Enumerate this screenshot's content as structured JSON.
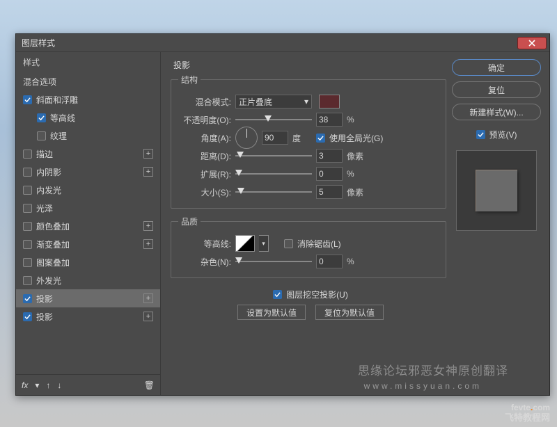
{
  "window": {
    "title": "图层样式"
  },
  "sidebar": {
    "header": "样式",
    "blend_options": "混合选项",
    "items": [
      {
        "label": "斜面和浮雕",
        "checked": true,
        "plus": false,
        "indent": 0
      },
      {
        "label": "等高线",
        "checked": true,
        "plus": false,
        "indent": 1
      },
      {
        "label": "纹理",
        "checked": false,
        "plus": false,
        "indent": 1
      },
      {
        "label": "描边",
        "checked": false,
        "plus": true,
        "indent": 0
      },
      {
        "label": "内阴影",
        "checked": false,
        "plus": true,
        "indent": 0
      },
      {
        "label": "内发光",
        "checked": false,
        "plus": false,
        "indent": 0
      },
      {
        "label": "光泽",
        "checked": false,
        "plus": false,
        "indent": 0
      },
      {
        "label": "颜色叠加",
        "checked": false,
        "plus": true,
        "indent": 0
      },
      {
        "label": "渐变叠加",
        "checked": false,
        "plus": true,
        "indent": 0
      },
      {
        "label": "图案叠加",
        "checked": false,
        "plus": false,
        "indent": 0
      },
      {
        "label": "外发光",
        "checked": false,
        "plus": false,
        "indent": 0
      },
      {
        "label": "投影",
        "checked": true,
        "plus": true,
        "indent": 0,
        "selected": true
      },
      {
        "label": "投影",
        "checked": true,
        "plus": true,
        "indent": 0
      }
    ],
    "footer_fx": "fx"
  },
  "panel": {
    "section_title": "投影",
    "group_structure": "结构",
    "blend_mode_label": "混合模式:",
    "blend_mode_value": "正片叠底",
    "swatch": "#5b2a2e",
    "opacity_label": "不透明度(O):",
    "opacity_value": "38",
    "opacity_unit": "%",
    "angle_label": "角度(A):",
    "angle_value": "90",
    "angle_unit": "度",
    "global_light": "使用全局光(G)",
    "distance_label": "距离(D):",
    "distance_value": "3",
    "distance_unit": "像素",
    "spread_label": "扩展(R):",
    "spread_value": "0",
    "spread_unit": "%",
    "size_label": "大小(S):",
    "size_value": "5",
    "size_unit": "像素",
    "group_quality": "品质",
    "contour_label": "等高线:",
    "antialias": "消除锯齿(L)",
    "noise_label": "杂色(N):",
    "noise_value": "0",
    "noise_unit": "%",
    "knockout": "图层挖空投影(U)",
    "make_default": "设置为默认值",
    "reset_default": "复位为默认值"
  },
  "right": {
    "ok": "确定",
    "reset": "复位",
    "new_style": "新建样式(W)...",
    "preview": "预览(V)"
  },
  "watermark": {
    "line1": "思缘论坛邪恶女神原创翻译",
    "line2": "www.missyuan.com",
    "logo1": "fevte.com",
    "logo2": "飞特教程网"
  }
}
